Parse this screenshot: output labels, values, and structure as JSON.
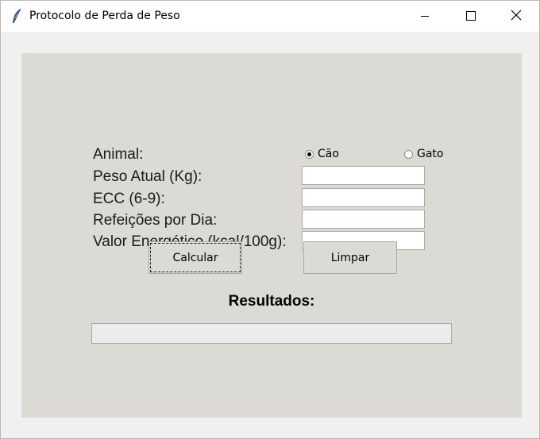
{
  "window": {
    "title": "Protocolo de Perda de Peso"
  },
  "form": {
    "animal_label": "Animal:",
    "animal_options": [
      {
        "label": "Cão",
        "selected": true
      },
      {
        "label": "Gato",
        "selected": false
      }
    ],
    "peso_label": "Peso Atual (Kg):",
    "peso_value": "",
    "ecc_label": "ECC (6-9):",
    "ecc_value": "",
    "refeicoes_label": "Refeições por Dia:",
    "refeicoes_value": "",
    "energia_label": "Valor Energético (kcal/100g):",
    "energia_value": ""
  },
  "buttons": {
    "calcular": "Calcular",
    "limpar": "Limpar"
  },
  "results": {
    "title": "Resultados:",
    "value": ""
  },
  "colors": {
    "frame_bg": "#dcdad5",
    "window_bg": "#f0f0f0"
  },
  "icons": {
    "app": "feather-icon",
    "minimize": "minimize-icon",
    "maximize": "maximize-icon",
    "close": "close-icon"
  }
}
